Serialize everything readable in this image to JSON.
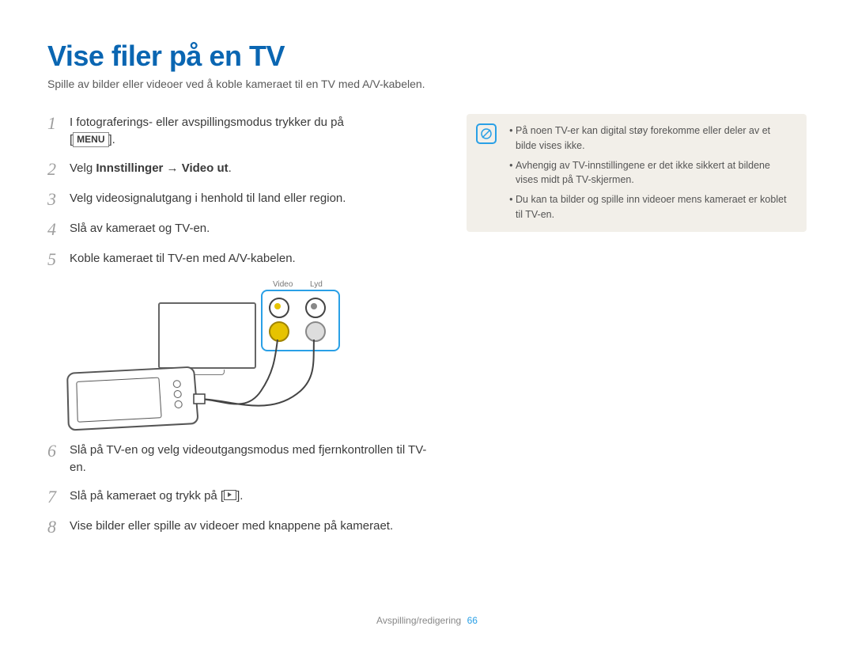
{
  "title": "Vise filer på en TV",
  "subtitle": "Spille av bilder eller videoer ved å koble kameraet til en TV med A/V-kabelen.",
  "steps": {
    "s1a": "I fotograferings- eller avspillingsmodus trykker du på",
    "s1b": "[",
    "s1_menu": "MENU",
    "s1c": "].",
    "s2a": "Velg ",
    "s2_bold": "Innstillinger → Video ut",
    "s2b": ".",
    "s3": "Velg videosignalutgang i henhold til land eller region.",
    "s4": "Slå av kameraet og TV-en.",
    "s5": "Koble kameraet til TV-en med A/V-kabelen.",
    "s6": "Slå på TV-en og velg videoutgangsmodus med fjernkontrollen til TV-en.",
    "s7a": "Slå på kameraet og trykk på [",
    "s7b": "].",
    "s8": "Vise bilder eller spille av videoer med knappene på kameraet."
  },
  "diagram": {
    "video_label": "Video",
    "audio_label": "Lyd"
  },
  "notes": {
    "n1": "På noen TV-er kan digital støy forekomme eller deler av et bilde vises ikke.",
    "n2": "Avhengig av TV-innstillingene er det ikke sikkert at bildene vises midt på TV-skjermen.",
    "n3": "Du kan ta bilder og spille inn videoer mens kameraet er koblet til TV-en."
  },
  "footer": {
    "section": "Avspilling/redigering",
    "page": "66"
  }
}
